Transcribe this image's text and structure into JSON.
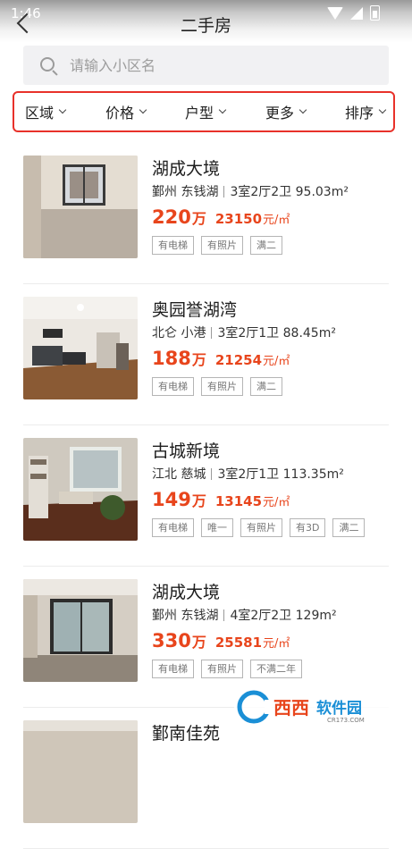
{
  "status_bar": {
    "time": "1:46"
  },
  "header": {
    "title": "二手房"
  },
  "search": {
    "placeholder": "请输入小区名"
  },
  "filters": [
    {
      "label": "区域"
    },
    {
      "label": "价格"
    },
    {
      "label": "户型"
    },
    {
      "label": "更多"
    },
    {
      "label": "排序"
    }
  ],
  "listings": [
    {
      "name": "湖成大境",
      "district": "鄞州",
      "area": "东钱湖",
      "layout": "3室2厅2卫 95.03m²",
      "total_price": "220",
      "total_unit": "万",
      "unit_price": "23150",
      "unit_price_unit": "元/㎡",
      "tags": [
        "有电梯",
        "有照片",
        "满二"
      ]
    },
    {
      "name": "奥园誉湖湾",
      "district": "北仑",
      "area": "小港",
      "layout": "3室2厅1卫 88.45m²",
      "total_price": "188",
      "total_unit": "万",
      "unit_price": "21254",
      "unit_price_unit": "元/㎡",
      "tags": [
        "有电梯",
        "有照片",
        "满二"
      ]
    },
    {
      "name": "古城新境",
      "district": "江北",
      "area": "慈城",
      "layout": "3室2厅1卫 113.35m²",
      "total_price": "149",
      "total_unit": "万",
      "unit_price": "13145",
      "unit_price_unit": "元/㎡",
      "tags": [
        "有电梯",
        "唯一",
        "有照片",
        "有3D",
        "满二"
      ]
    },
    {
      "name": "湖成大境",
      "district": "鄞州",
      "area": "东钱湖",
      "layout": "4室2厅2卫 129m²",
      "total_price": "330",
      "total_unit": "万",
      "unit_price": "25581",
      "unit_price_unit": "元/㎡",
      "tags": [
        "有电梯",
        "有照片",
        "不满二年"
      ]
    },
    {
      "name": "鄞南佳苑"
    }
  ],
  "watermark": {
    "text": "西西软件园",
    "url": "CR173.COM"
  },
  "colors": {
    "accent": "#e8451c",
    "highlight_border": "#e8312a"
  }
}
